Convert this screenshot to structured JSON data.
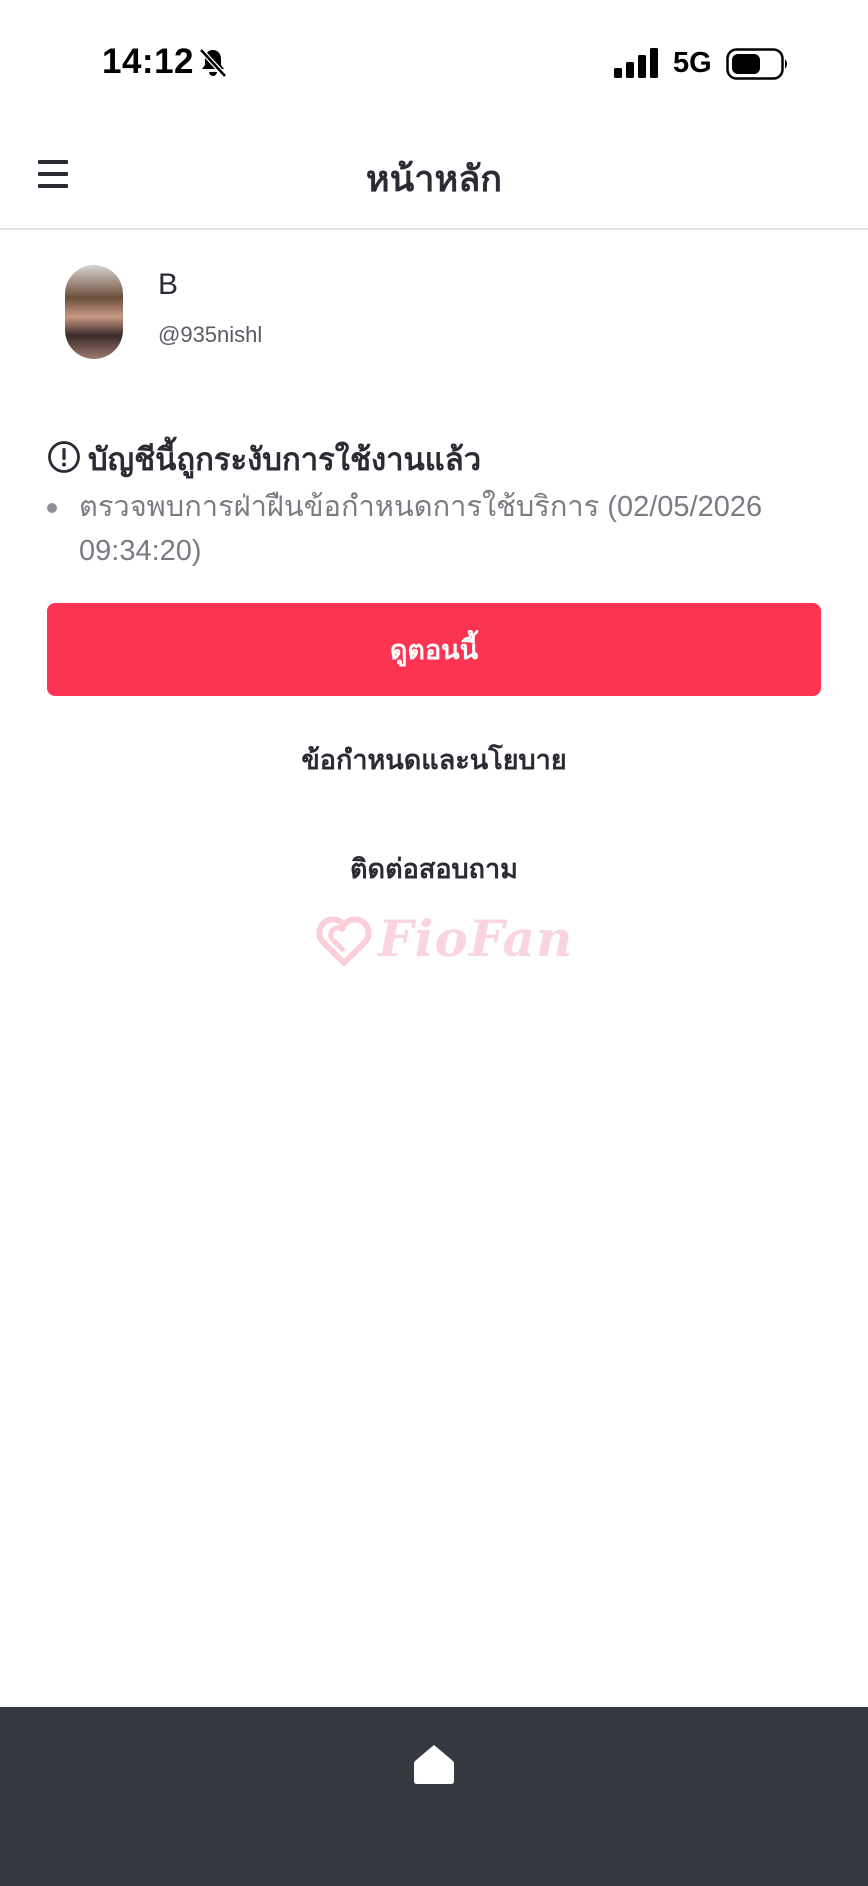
{
  "status_bar": {
    "time": "14:12",
    "network": "5G",
    "icons": [
      "bell-off-icon",
      "signal-icon",
      "battery-icon"
    ]
  },
  "header": {
    "title": "หน้าหลัก",
    "menu_icon": "menu-icon"
  },
  "profile": {
    "name": "B",
    "handle": "@935nishl"
  },
  "notice": {
    "icon": "alert-circle-icon",
    "title": "บัญชีนี้ถูกระงับการใช้งานแล้ว",
    "reasons": [
      "ตรวจพบการฝ่าฝืนข้อกำหนดการใช้บริการ (02/05/2026 09:34:20)"
    ]
  },
  "actions": {
    "view_now_label": "ดูตอนนี้",
    "terms_label": "ข้อกำหนดและนโยบาย",
    "contact_label": "ติดต่อสอบถาม"
  },
  "brand": {
    "logo_text": "FioFan"
  },
  "bottom_nav": {
    "home_icon": "home-icon"
  },
  "colors": {
    "accent": "#fd3352",
    "nav_background": "#373941",
    "text_primary": "#2a2b33",
    "text_secondary": "#7b7c83"
  }
}
